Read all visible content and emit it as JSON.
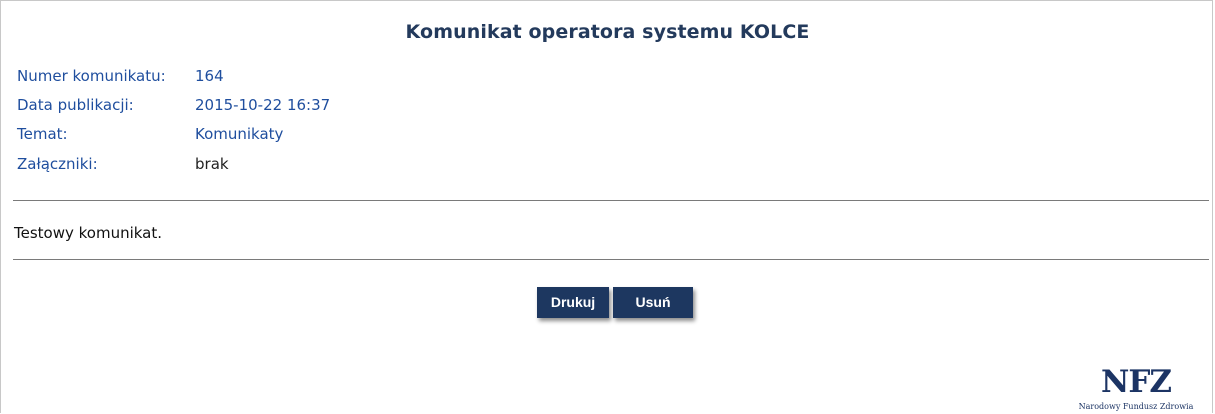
{
  "page": {
    "title": "Komunikat operatora systemu KOLCE"
  },
  "details": {
    "number_label": "Numer komunikatu:",
    "number_value": "164",
    "date_label": "Data publikacji:",
    "date_value": "2015-10-22 16:37",
    "topic_label": "Temat:",
    "topic_value": "Komunikaty",
    "attachments_label": "Załączniki:",
    "attachments_value": "brak"
  },
  "message": {
    "body": "Testowy komunikat."
  },
  "actions": {
    "print_label": "Drukuj",
    "delete_label": "Usuń"
  },
  "logo": {
    "mark": "NFZ",
    "caption": "Narodowy Fundusz Zdrowia"
  },
  "colors": {
    "title": "#233a5c",
    "label": "#1f4e9e",
    "button": "#1d3760",
    "rule": "#7a7a7a"
  }
}
